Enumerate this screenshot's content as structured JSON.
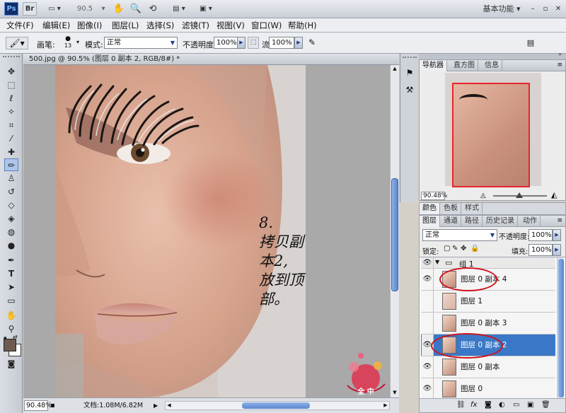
{
  "app": {
    "logo": "Ps",
    "bridge": "Br",
    "zoom": "90.5",
    "workspace": "基本功能"
  },
  "menu": [
    "文件(F)",
    "编辑(E)",
    "图像(I)",
    "图层(L)",
    "选择(S)",
    "滤镜(T)",
    "视图(V)",
    "窗口(W)",
    "帮助(H)"
  ],
  "options": {
    "brush_label": "画笔:",
    "brush_size": "13",
    "mode_label": "模式:",
    "mode_value": "正常",
    "opacity_label": "不透明度:",
    "opacity_value": "100%",
    "flow_label": "流量:",
    "flow_value": "100%"
  },
  "document": {
    "tab_title": "500.jpg @ 90.5% (图层 0 副本 2, RGB/8#) *",
    "zoom": "90.48%",
    "doc_info": "文档:1.08M/6.82M"
  },
  "annotation": {
    "line1": "8.",
    "line2": "拷贝副本2,",
    "line3": "放到顶部。"
  },
  "watermark": {
    "text": "全 中"
  },
  "navigator": {
    "tabs": [
      "导航器",
      "直方图",
      "信息"
    ],
    "zoom": "90.48%"
  },
  "color_panel": {
    "tabs": [
      "颜色",
      "色板",
      "样式"
    ]
  },
  "layers_panel": {
    "tabs": [
      "图层",
      "通道",
      "路径",
      "历史记录",
      "动作"
    ],
    "blend_mode": "正常",
    "opacity_label": "不透明度:",
    "opacity": "100%",
    "lock_label": "锁定:",
    "fill_label": "填充:",
    "fill": "100%",
    "group_name": "组 1",
    "layers": [
      "图层 0 副本 4",
      "图层 1",
      "图层 0 副本 3",
      "图层 0 副本 2",
      "图层 0 副本",
      "图层 0"
    ]
  },
  "colors": {
    "selection": "#3a78c7",
    "circle": "#d0121c",
    "foreground": "#6e5a50"
  }
}
